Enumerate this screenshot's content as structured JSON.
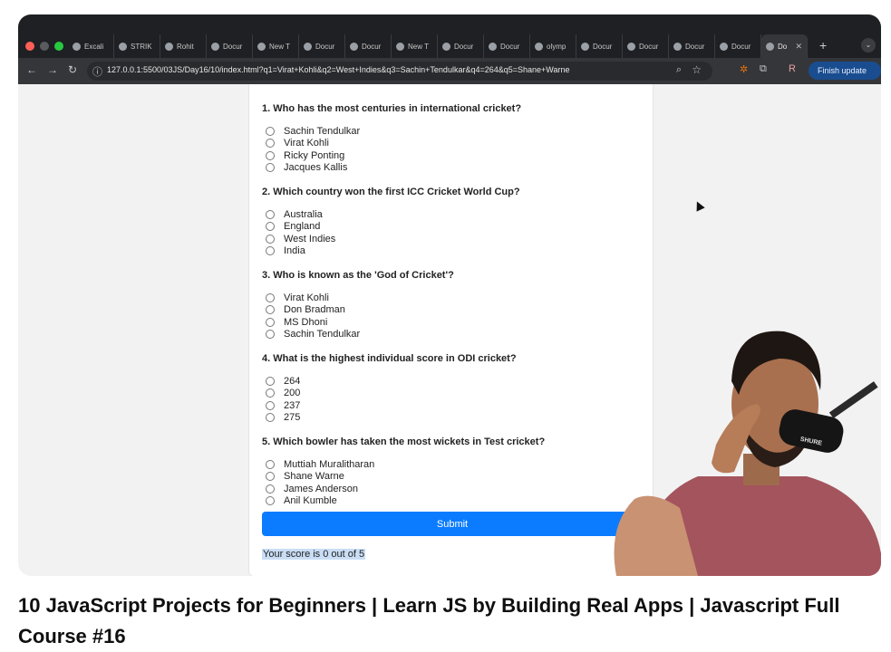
{
  "browser": {
    "tabs": [
      {
        "label": "Excali",
        "icon": "excalidraw-icon"
      },
      {
        "label": "STRIK",
        "icon": "strike-icon"
      },
      {
        "label": "Rohit",
        "icon": "globe-icon"
      },
      {
        "label": "Docur",
        "icon": "globe-icon"
      },
      {
        "label": "New T",
        "icon": "chrome-icon"
      },
      {
        "label": "Docur",
        "icon": "globe-icon"
      },
      {
        "label": "Docur",
        "icon": "globe-icon"
      },
      {
        "label": "New T",
        "icon": "chrome-icon"
      },
      {
        "label": "Docur",
        "icon": "globe-icon"
      },
      {
        "label": "Docur",
        "icon": "globe-icon"
      },
      {
        "label": "olymp",
        "icon": "google-icon"
      },
      {
        "label": "Docur",
        "icon": "globe-icon"
      },
      {
        "label": "Docur",
        "icon": "globe-icon"
      },
      {
        "label": "Docur",
        "icon": "globe-icon"
      },
      {
        "label": "Docur",
        "icon": "globe-icon"
      },
      {
        "label": "Do",
        "icon": "globe-icon",
        "active": true
      }
    ],
    "url": "127.0.0.1:5500/03JS/Day16/10/index.html?q1=Virat+Kohli&q2=West+Indies&q3=Sachin+Tendulkar&q4=264&q5=Shane+Warne",
    "finish_update": "Finish update",
    "profile_initial": "R"
  },
  "quiz": {
    "questions": [
      {
        "text": "1. Who has the most centuries in international cricket?",
        "options": [
          "Sachin Tendulkar",
          "Virat Kohli",
          "Ricky Ponting",
          "Jacques Kallis"
        ]
      },
      {
        "text": "2. Which country won the first ICC Cricket World Cup?",
        "options": [
          "Australia",
          "England",
          "West Indies",
          "India"
        ]
      },
      {
        "text": "3. Who is known as the 'God of Cricket'?",
        "options": [
          "Virat Kohli",
          "Don Bradman",
          "MS Dhoni",
          "Sachin Tendulkar"
        ]
      },
      {
        "text": "4. What is the highest individual score in ODI cricket?",
        "options": [
          "264",
          "200",
          "237",
          "275"
        ]
      },
      {
        "text": "5. Which bowler has taken the most wickets in Test cricket?",
        "options": [
          "Muttiah Muralitharan",
          "Shane Warne",
          "James Anderson",
          "Anil Kumble"
        ]
      }
    ],
    "submit_label": "Submit",
    "score_text": "Your score is 0 out of 5"
  },
  "video_title": "10 JavaScript Projects for Beginners | Learn JS by Building Real Apps | Javascript Full Course #16",
  "colors": {
    "submit": "#0b7cff",
    "chrome_bg": "#1f2023",
    "finish_btn": "#1a4d8f"
  }
}
